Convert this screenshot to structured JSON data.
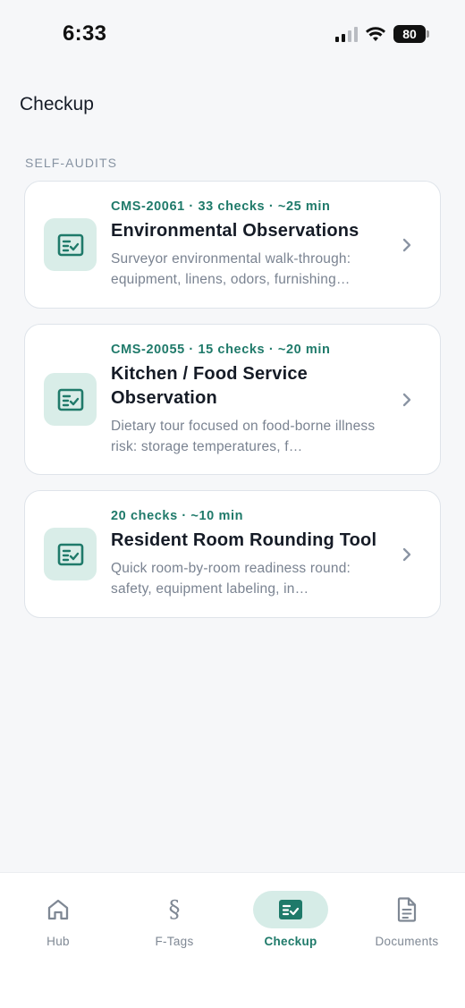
{
  "status_bar": {
    "time": "6:33",
    "battery": "80",
    "icons": [
      "signal-icon",
      "wifi-icon",
      "battery-icon"
    ]
  },
  "page": {
    "title": "Checkup",
    "section_label": "SELF-AUDITS"
  },
  "audits": [
    {
      "meta": "CMS-20061 · 33 checks · ~25 min",
      "title": "Environmental Observations",
      "description": "Surveyor environmental walk-through: equipment, linens, odors, furnishing…",
      "icon": "checklist-icon"
    },
    {
      "meta": "CMS-20055 · 15 checks · ~20 min",
      "title": "Kitchen / Food Service Observation",
      "description": "Dietary tour focused on food-borne illness risk: storage temperatures, f…",
      "icon": "checklist-icon"
    },
    {
      "meta": "20 checks · ~10 min",
      "title": "Resident Room Rounding Tool",
      "description": "Quick room-by-room readiness round: safety, equipment labeling, in…",
      "icon": "checklist-icon"
    }
  ],
  "nav": {
    "items": [
      {
        "label": "Hub",
        "icon": "home-icon"
      },
      {
        "label": "F-Tags",
        "icon": "section-sign-icon",
        "glyph": "§"
      },
      {
        "label": "Checkup",
        "icon": "checklist-icon",
        "active": true
      },
      {
        "label": "Documents",
        "icon": "document-icon"
      }
    ]
  },
  "colors": {
    "accent": "#1f7a6a",
    "accent_soft": "#d9ede8",
    "background": "#f6f7f9",
    "muted": "#7a8391"
  }
}
